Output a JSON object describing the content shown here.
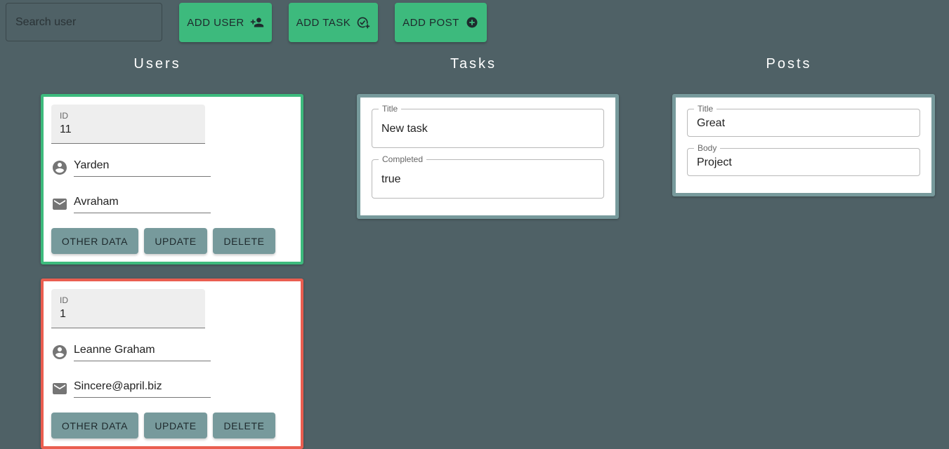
{
  "toolbar": {
    "search_placeholder": "Search user",
    "add_user_label": "ADD USER",
    "add_task_label": "ADD TASK",
    "add_post_label": "ADD POST",
    "add_user_icon": "person-add-icon",
    "add_task_icon": "task-add-icon",
    "add_post_icon": "add-circle-icon"
  },
  "columns": {
    "users": "Users",
    "tasks": "Tasks",
    "posts": "Posts"
  },
  "users": [
    {
      "id_label": "ID",
      "id": "11",
      "name": "Yarden",
      "email": "Avraham",
      "status_color": "#3dba7d",
      "other_label": "OTHER DATA",
      "update_label": "UPDATE",
      "delete_label": "DELETE"
    },
    {
      "id_label": "ID",
      "id": "1",
      "name": "Leanne Graham",
      "email": "Sincere@april.biz",
      "status_color": "#ea5e50",
      "other_label": "OTHER DATA",
      "update_label": "UPDATE",
      "delete_label": "DELETE"
    }
  ],
  "task": {
    "title_label": "Title",
    "title": "New task",
    "completed_label": "Completed",
    "completed": "true"
  },
  "post": {
    "title_label": "Title",
    "title": "Great",
    "body_label": "Body",
    "body": "Project"
  },
  "colors": {
    "background": "#4f6166",
    "accent_green": "#3dba7d",
    "alert_red": "#ea5e50",
    "muted_teal": "#779a9c"
  }
}
